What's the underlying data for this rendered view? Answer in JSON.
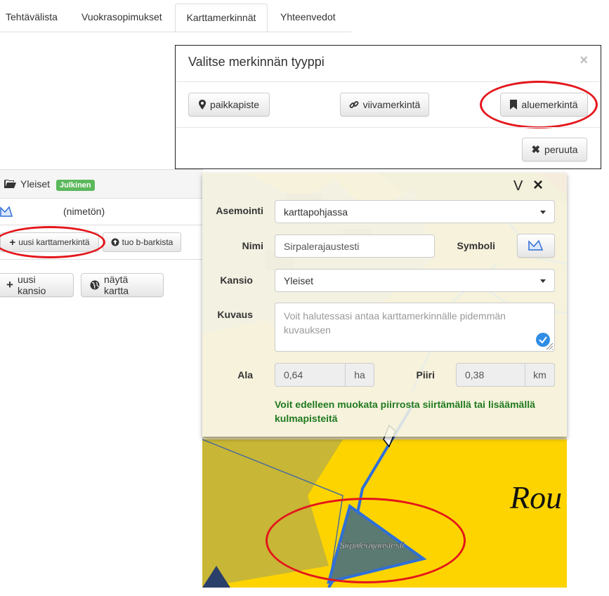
{
  "tabs": [
    {
      "label": "Tehtävälista",
      "active": false
    },
    {
      "label": "Vuokrasopimukset",
      "active": false
    },
    {
      "label": "Karttamerkinnät",
      "active": true
    },
    {
      "label": "Yhteenvedot",
      "active": false
    }
  ],
  "modal": {
    "title": "Valitse merkinnän tyyppi",
    "close": "×",
    "buttons": {
      "point": "paikkapiste",
      "line": "viivamerkintä",
      "area": "aluemerkintä",
      "cancel": "peruuta"
    }
  },
  "folder": {
    "name": "Yleiset",
    "badge": "Julkinen",
    "item_name": "(nimetön)",
    "new_marking": "uusi karttamerkintä",
    "import": "tuo b-barkista",
    "new_folder": "uusi kansio",
    "show_map": "näytä kartta"
  },
  "form": {
    "v_label": "V",
    "close": "×",
    "positioning_label": "Asemointi",
    "positioning_value": "karttapohjassa",
    "name_label": "Nimi",
    "name_value": "Sirpalerajaustesti",
    "symbol_label": "Symboli",
    "folder_label": "Kansio",
    "folder_value": "Yleiset",
    "description_label": "Kuvaus",
    "description_placeholder": "Voit halutessasi antaa karttamerkinnälle pidemmän kuvauksen",
    "area_label": "Ala",
    "area_value": "0,64",
    "area_unit": "ha",
    "perimeter_label": "Piiri",
    "perimeter_value": "0,38",
    "perimeter_unit": "km",
    "hint": "Voit edelleen muokata piirrosta siirtämällä tai lisäämällä kulmapisteitä"
  },
  "map": {
    "place_label": "Rou",
    "area_label": "Sirpalerajaustesti"
  },
  "colors": {
    "accent_red": "#e4161b",
    "map_yellow": "#fdd400",
    "polygon_blue": "#2f6fd8",
    "hint_green": "#1f7a1f",
    "badge_green": "#5cb85c"
  }
}
